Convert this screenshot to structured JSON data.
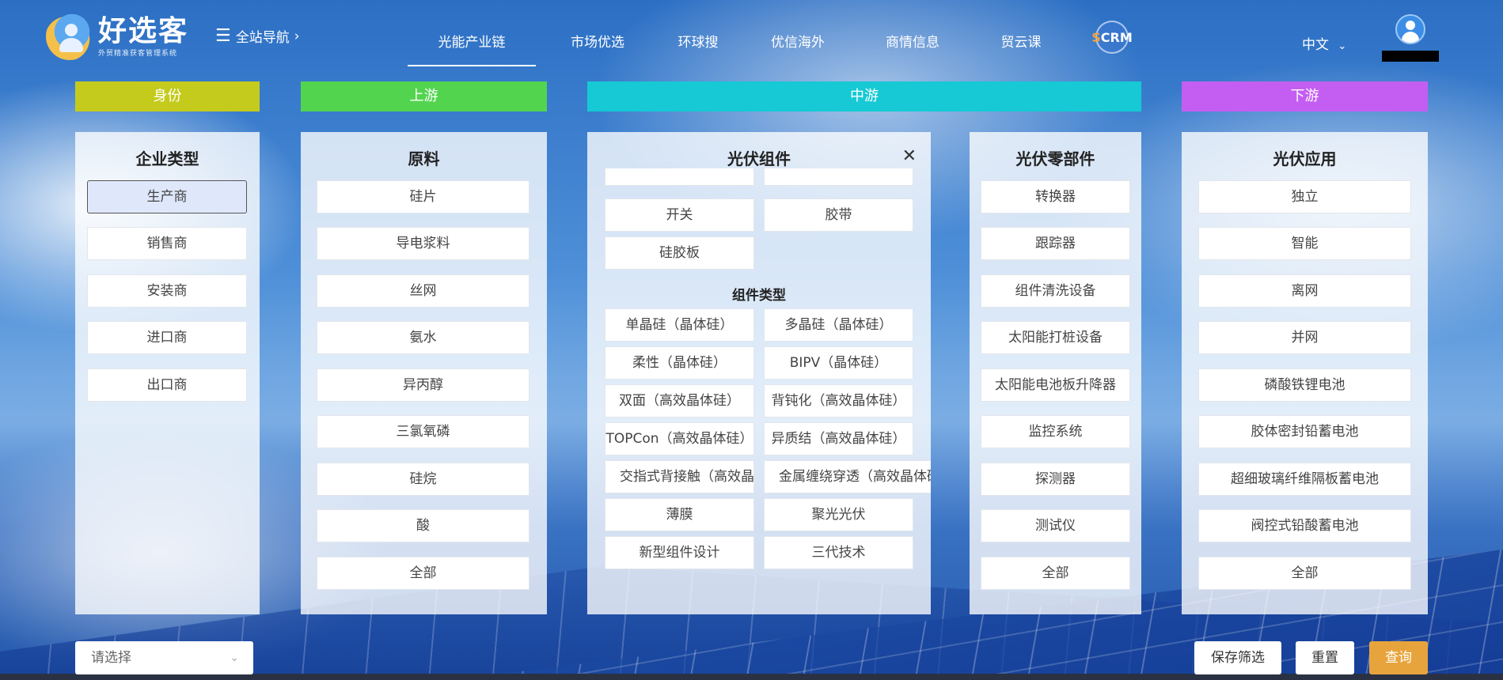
{
  "header": {
    "logo_name": "好选客",
    "logo_sub": "外贸精准获客管理系统",
    "site_nav": "全站导航",
    "nav": [
      {
        "label": "光能产业链",
        "active": true
      },
      {
        "label": "市场优选"
      },
      {
        "label": "环球搜"
      },
      {
        "label": "优信海外"
      },
      {
        "label": "商情信息"
      },
      {
        "label": "贸云课"
      }
    ],
    "scrm_s": "S",
    "scrm_rest": "CRM",
    "language": "中文"
  },
  "categories": {
    "identity": {
      "label": "身份",
      "color": "#c4cb1c"
    },
    "upstream": {
      "label": "上游",
      "color": "#53d44f"
    },
    "midstream": {
      "label": "中游",
      "color": "#16c9d4"
    },
    "downstream": {
      "label": "下游",
      "color": "#c45ef2"
    }
  },
  "panels": {
    "enterprise": {
      "title": "企业类型",
      "items": [
        "生产商",
        "销售商",
        "安装商",
        "进口商",
        "出口商"
      ],
      "selected_index": 0
    },
    "materials": {
      "title": "原料",
      "items": [
        "硅片",
        "导电浆料",
        "丝网",
        "氨水",
        "异丙醇",
        "三氯氧磷",
        "硅烷",
        "酸",
        "全部"
      ]
    },
    "modules": {
      "title": "光伏组件",
      "top_items": [
        "开关",
        "胶带",
        "硅胶板"
      ],
      "subhead": "组件类型",
      "type_items": [
        "单晶硅（晶体硅）",
        "多晶硅（晶体硅）",
        "柔性（晶体硅）",
        "BIPV（晶体硅）",
        "双面（高效晶体硅）",
        "背钝化（高效晶体硅）",
        "TOPCon（高效晶体硅）",
        "异质结（高效晶体硅）",
        "交指式背接触（高效晶体硅）",
        "金属缠绕穿透（高效晶体硅）",
        "薄膜",
        "聚光光伏",
        "新型组件设计",
        "三代技术"
      ]
    },
    "parts": {
      "title": "光伏零部件",
      "items": [
        "转换器",
        "跟踪器",
        "组件清洗设备",
        "太阳能打桩设备",
        "太阳能电池板升降器",
        "监控系统",
        "探测器",
        "测试仪",
        "全部"
      ]
    },
    "applications": {
      "title": "光伏应用",
      "items": [
        "独立",
        "智能",
        "离网",
        "并网",
        "磷酸铁锂电池",
        "胶体密封铅蓄电池",
        "超细玻璃纤维隔板蓄电池",
        "阀控式铅酸蓄电池",
        "全部"
      ]
    }
  },
  "footer": {
    "select_placeholder": "请选择",
    "save_filter": "保存筛选",
    "reset": "重置",
    "query": "查询",
    "query_color": "#e8a43c"
  }
}
